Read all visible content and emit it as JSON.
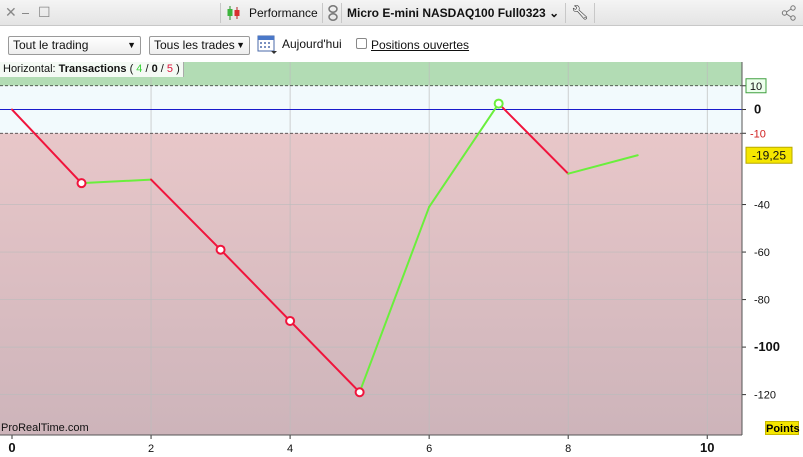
{
  "window": {
    "performance_label": "Performance",
    "instrument": "Micro E-mini NASDAQ100 Full0323",
    "instrument_chevron": "⌄"
  },
  "toolbar": {
    "scope_select": "Tout le trading",
    "trades_select": "Tous les trades",
    "today_label": "Aujourd'hui",
    "open_positions_label": "Positions ouvertes",
    "open_positions_checked": false
  },
  "horizontal": {
    "prefix": "Horizontal:",
    "name": "Transactions",
    "open_paren": "(",
    "wins": "4",
    "sep1": "/",
    "even": "0",
    "sep2": "/",
    "losses": "5",
    "close_paren": ")"
  },
  "brand": "ProRealTime.com",
  "units_label": "Points",
  "colors": {
    "win": "#6aef3c",
    "loss": "#f0143c",
    "zero_line": "#1a1acc",
    "profit_zone": "#b2dcb4",
    "loss_zone": "#e8c7c9",
    "current_badge": "#f5e600"
  },
  "chart_data": {
    "type": "line",
    "x": [
      0,
      1,
      2,
      3,
      4,
      5,
      6,
      7,
      8,
      9
    ],
    "y": [
      0,
      -31,
      -29.5,
      -59,
      -89,
      -119,
      -41,
      2.5,
      -27,
      -19.25
    ],
    "segment_result": [
      "loss",
      "win",
      "loss",
      "loss",
      "loss",
      "win",
      "win",
      "loss",
      "win"
    ],
    "trade_markers": [
      1,
      3,
      4,
      5,
      7
    ],
    "xlim": [
      0,
      10.5
    ],
    "ylim": [
      -137,
      20
    ],
    "x_ticks": [
      "0",
      "2",
      "4",
      "6",
      "8",
      "10"
    ],
    "x_tick_values": [
      0,
      2,
      4,
      6,
      8,
      10
    ],
    "y_ticks": [
      "10",
      "0",
      "-10",
      "-40",
      "-60",
      "-80",
      "-100",
      "-120"
    ],
    "y_tick_values": [
      10,
      0,
      -10,
      -40,
      -60,
      -80,
      -100,
      -120
    ],
    "upper_threshold": 10,
    "lower_threshold": -10,
    "current_value": -19.25,
    "current_value_label": "-19,25",
    "grid": true
  }
}
